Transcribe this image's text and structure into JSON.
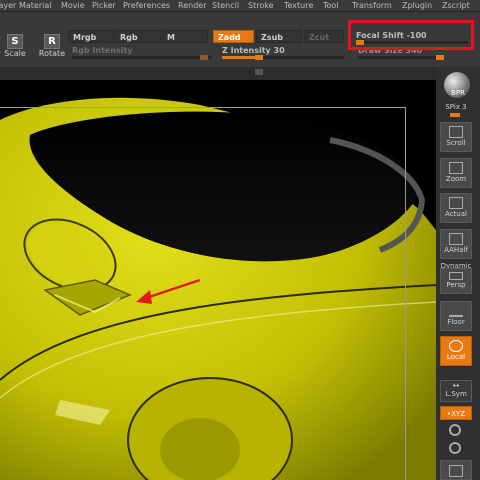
{
  "menu": [
    "Layer",
    "Material",
    "Movie",
    "Picker",
    "Preferences",
    "Render",
    "Stencil",
    "Stroke",
    "Texture",
    "Tool",
    "Transform",
    "Zplugin",
    "Zscript"
  ],
  "toolbar": {
    "scale_label": "Scale",
    "rotate_label": "Rotate",
    "scale_glyph": "S",
    "rotate_glyph": "R",
    "mrgb": "Mrgb",
    "rgb": "Rgb",
    "m": "M",
    "zadd": "Zadd",
    "zsub": "Zsub",
    "zcut": "Zcut",
    "rgb_intensity": "Rgb Intensity",
    "z_intensity": "Z Intensity 30",
    "focal_shift": "Focal Shift -100",
    "draw_size": "Draw Size 340"
  },
  "sliders": {
    "z_intensity_fraction": 0.3,
    "focal_shift_fraction": 0.0,
    "draw_size_fraction": 0.95
  },
  "right_panel": {
    "bpr": "BPR",
    "spix": "SPix 3",
    "scroll": "Scroll",
    "zoom": "Zoom",
    "actual": "Actual",
    "aahalf": "AAHalf",
    "dynamic": "Dynamic",
    "persp": "Persp",
    "floor": "Floor",
    "local": "Local",
    "lsym": "L.Sym",
    "xyz": "•XYZ"
  },
  "colors": {
    "accent": "#e87a14",
    "highlight": "#e3141c",
    "mesh": "#c8c400",
    "arrow": "#e31a1a"
  }
}
